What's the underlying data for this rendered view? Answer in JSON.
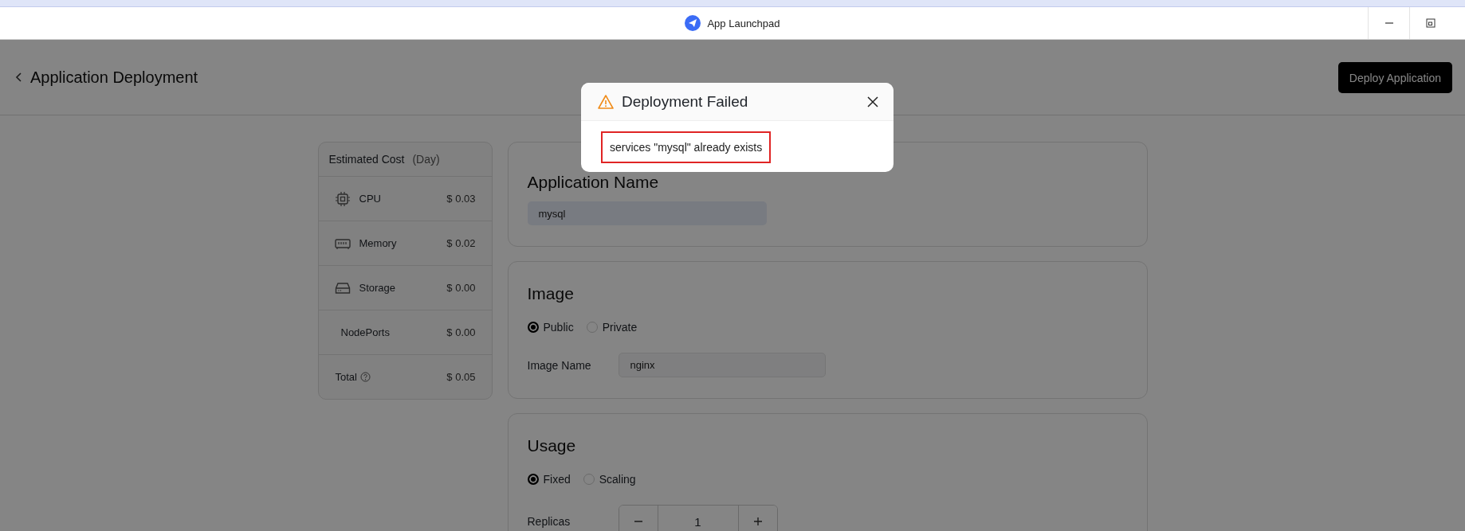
{
  "window": {
    "title": "App Launchpad"
  },
  "header": {
    "title": "Application Deployment",
    "deploy_button": "Deploy Application"
  },
  "cost": {
    "title": "Estimated Cost",
    "period": "(Day)",
    "items": [
      {
        "kind": "cpu",
        "label": "CPU",
        "value": "$ 0.03"
      },
      {
        "kind": "memory",
        "label": "Memory",
        "value": "$ 0.02"
      },
      {
        "kind": "storage",
        "label": "Storage",
        "value": "$ 0.00"
      },
      {
        "kind": "plain",
        "label": "NodePorts",
        "value": "$ 0.00"
      },
      {
        "kind": "total",
        "label": "Total",
        "value": "$ 0.05"
      }
    ]
  },
  "app_name": {
    "title": "Application Name",
    "value": "mysql"
  },
  "image": {
    "title": "Image",
    "options": [
      {
        "label": "Public",
        "selected": true
      },
      {
        "label": "Private",
        "selected": false
      }
    ],
    "name_label": "Image Name",
    "name_value": "nginx"
  },
  "usage": {
    "title": "Usage",
    "options": [
      {
        "label": "Fixed",
        "selected": true
      },
      {
        "label": "Scaling",
        "selected": false
      }
    ],
    "replicas_label": "Replicas",
    "replicas_value": "1"
  },
  "dialog": {
    "title": "Deployment Failed",
    "message": "services \"mysql\" already exists"
  }
}
